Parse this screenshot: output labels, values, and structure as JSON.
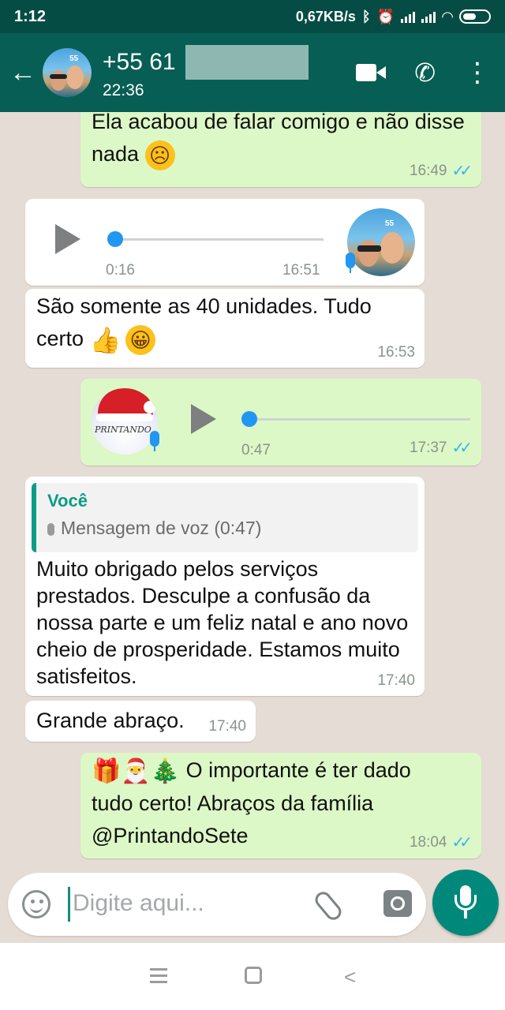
{
  "status_bar": {
    "time": "1:12",
    "network_speed": "0,67KB/s",
    "icons": [
      "bluetooth-icon",
      "alarm-icon",
      "signal-icon",
      "signal-icon",
      "wifi-icon",
      "battery-icon"
    ]
  },
  "header": {
    "contact_name": "+55 61",
    "last_seen": "22:36",
    "icons": [
      "back-arrow-icon",
      "video-call-icon",
      "phone-icon",
      "more-options-icon"
    ]
  },
  "messages": [
    {
      "direction": "outgoing",
      "text": "Ela acabou de falar comigo e não disse nada",
      "emoji": "☹",
      "time": "16:49",
      "status": "read"
    },
    {
      "direction": "incoming",
      "type": "voice",
      "duration": "0:16",
      "time": "16:51"
    },
    {
      "direction": "incoming",
      "text": "São somente as 40 unidades. Tudo certo",
      "emoji": [
        "👍",
        "😀"
      ],
      "time": "16:53"
    },
    {
      "direction": "outgoing",
      "type": "voice",
      "duration": "0:47",
      "time": "17:37",
      "status": "read",
      "avatar_text": "PRINTANDO"
    },
    {
      "direction": "incoming",
      "reply_to": {
        "author": "Você",
        "snippet": "Mensagem de voz (0:47)"
      },
      "text": "Muito obrigado pelos serviços prestados. Desculpe a confusão da nossa parte e um feliz natal e ano novo cheio de prosperidade. Estamos muito satisfeitos.",
      "time": "17:40"
    },
    {
      "direction": "incoming",
      "text": "Grande abraço.",
      "time": "17:40"
    },
    {
      "direction": "outgoing",
      "emoji": [
        "🎁",
        "🎅",
        "🎄"
      ],
      "text": "O importante é ter dado tudo certo! Abraços da família @PrintandoSete",
      "time": "18:04",
      "status": "read"
    }
  ],
  "input": {
    "placeholder": "Digite aqui..."
  },
  "colors": {
    "header": "#075e54",
    "status_bar": "#054d44",
    "outgoing_bubble": "#dcf8c6",
    "incoming_bubble": "#ffffff",
    "chat_bg": "#e5ddd5",
    "read_ticks": "#34b7f1",
    "voice_accent": "#2196f3",
    "fab": "#00897b"
  }
}
